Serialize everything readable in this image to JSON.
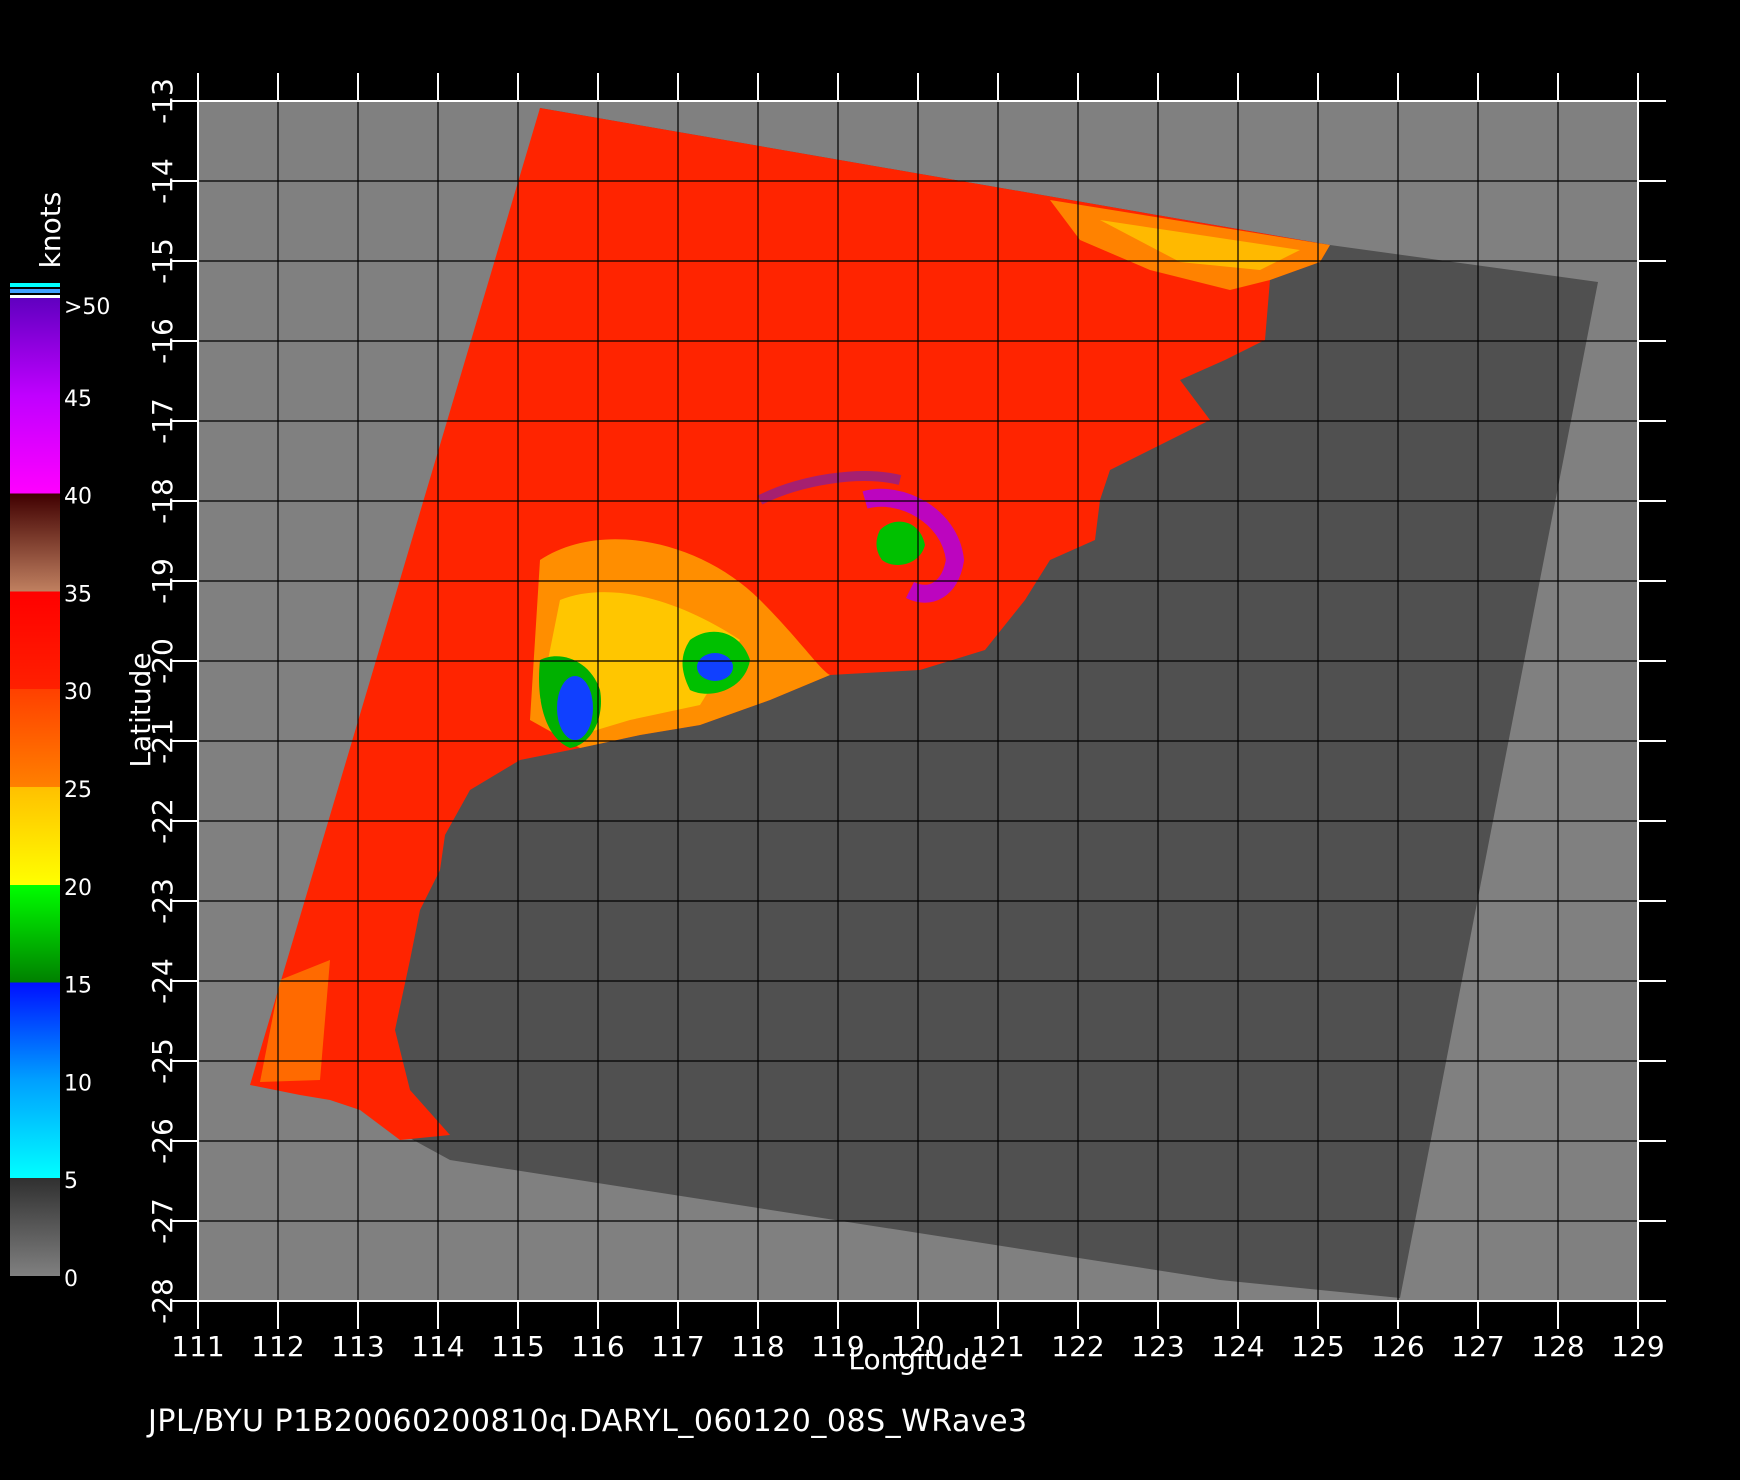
{
  "colors": {
    "background": "#000000",
    "land": "#505050",
    "no_data": "#808080",
    "grid": "#000000",
    "axis": "#ffffff"
  },
  "axes": {
    "xlabel": "Longitude",
    "ylabel": "Latitude",
    "xlim": [
      111,
      129
    ],
    "ylim": [
      -28,
      -13
    ],
    "x_ticks": [
      "111",
      "112",
      "113",
      "114",
      "115",
      "116",
      "117",
      "118",
      "119",
      "120",
      "121",
      "122",
      "123",
      "124",
      "125",
      "126",
      "127",
      "128",
      "129"
    ],
    "y_ticks": [
      "-13",
      "-14",
      "-15",
      "-16",
      "-17",
      "-18",
      "-19",
      "-20",
      "-21",
      "-22",
      "-23",
      "-24",
      "-25",
      "-26",
      "-27",
      "-28"
    ]
  },
  "colorbar": {
    "unit_label": "knots",
    "labels": [
      ">50",
      "45",
      "40",
      "35",
      "30",
      "25",
      "20",
      "15",
      "10",
      "5",
      "0"
    ],
    "stops": [
      {
        "value": 0,
        "color": "#808080"
      },
      {
        "value": 5,
        "color": "#303030"
      },
      {
        "value": 5,
        "color": "#00ffff"
      },
      {
        "value": 10,
        "color": "#00a0ff"
      },
      {
        "value": 15,
        "color": "#0010ff"
      },
      {
        "value": 15,
        "color": "#008000"
      },
      {
        "value": 20,
        "color": "#00ff00"
      },
      {
        "value": 20,
        "color": "#ffff00"
      },
      {
        "value": 25,
        "color": "#ffc000"
      },
      {
        "value": 25,
        "color": "#ff8000"
      },
      {
        "value": 30,
        "color": "#ff4000"
      },
      {
        "value": 30,
        "color": "#ff2000"
      },
      {
        "value": 35,
        "color": "#ff0000"
      },
      {
        "value": 35,
        "color": "#c08060"
      },
      {
        "value": 40,
        "color": "#400000"
      },
      {
        "value": 40,
        "color": "#ff00ff"
      },
      {
        "value": 45,
        "color": "#c000ff"
      },
      {
        "value": 50,
        "color": "#6000c0"
      }
    ]
  },
  "footer": {
    "title": "JPL/BYU  P1B20060200810q.DARYL_060120_08S_WRave3"
  }
}
